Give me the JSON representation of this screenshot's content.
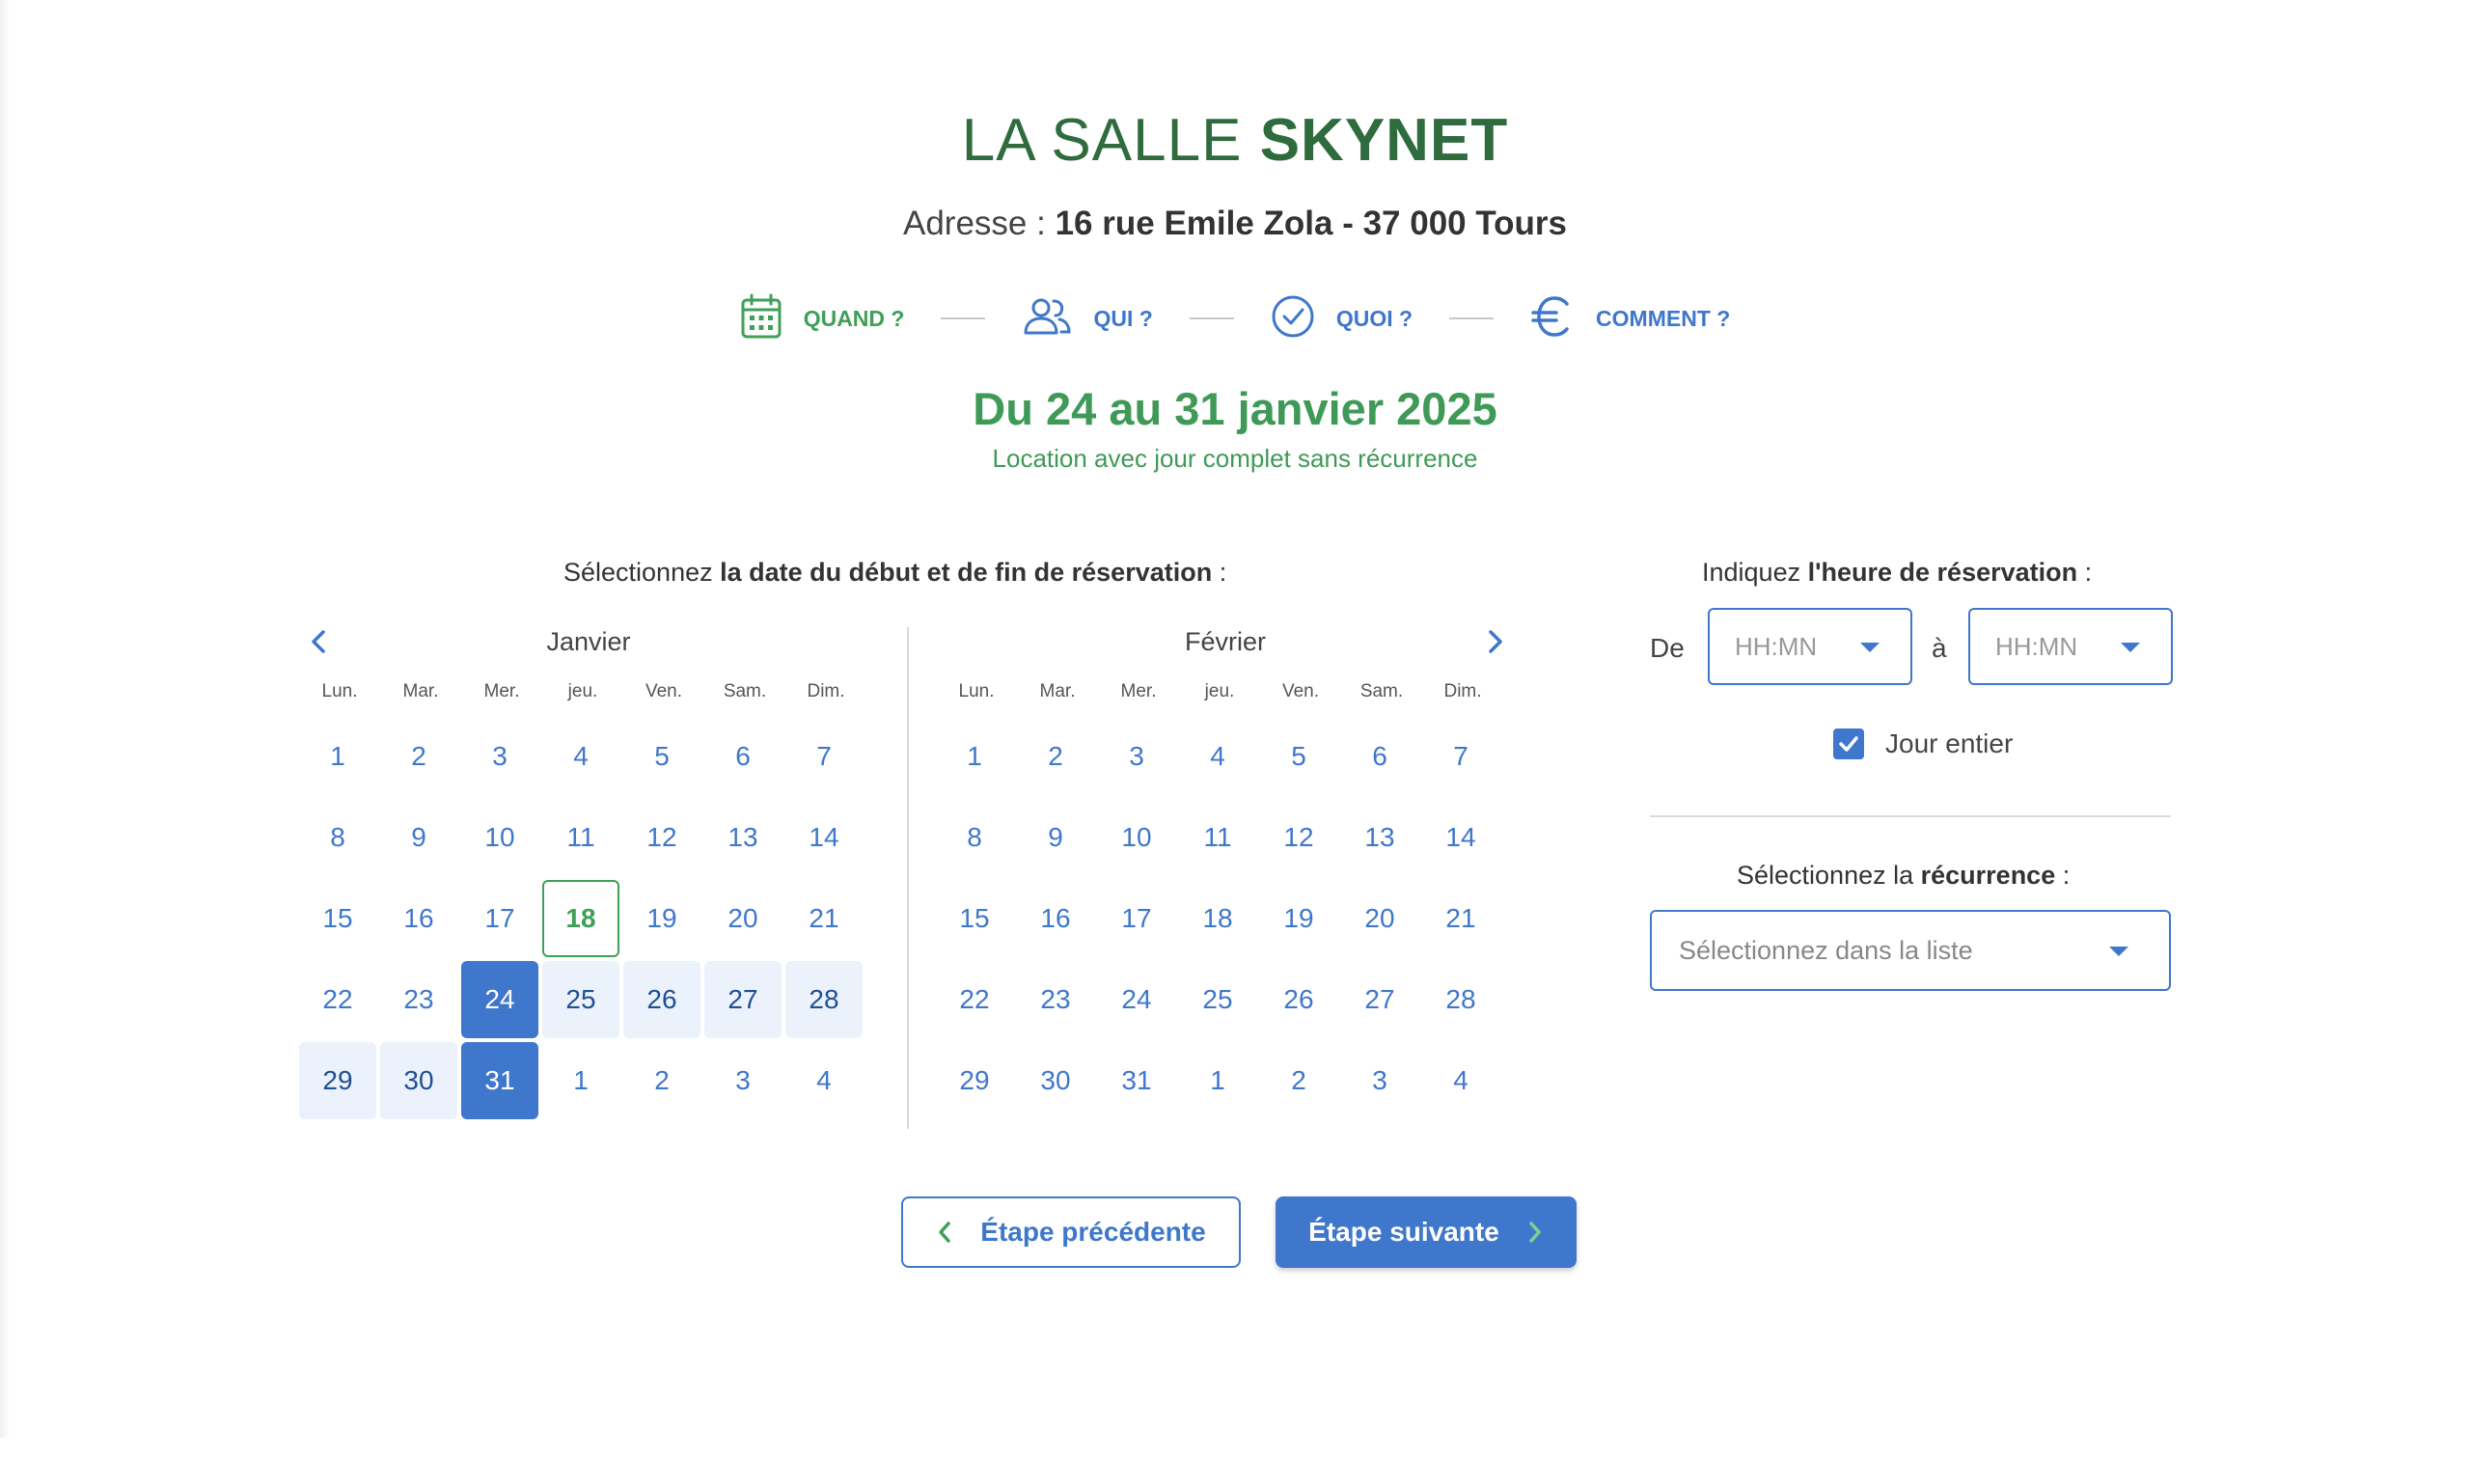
{
  "header": {
    "title_prefix": "LA SALLE",
    "title_name": "SKYNET",
    "address_label": "Adresse :",
    "address_value": "16 rue Emile Zola - 37 000 Tours"
  },
  "steps": [
    {
      "label": "QUAND ?",
      "icon": "calendar-icon",
      "state": "active"
    },
    {
      "label": "QUI ?",
      "icon": "people-icon",
      "state": "pending"
    },
    {
      "label": "QUOI ?",
      "icon": "check-circle-icon",
      "state": "pending"
    },
    {
      "label": "COMMENT ?",
      "icon": "euro-icon",
      "state": "pending"
    }
  ],
  "summary": {
    "period": "Du 24 au 31 janvier 2025",
    "subtitle": "Location avec jour complet sans récurrence"
  },
  "date_section": {
    "label_start": "Sélectionnez ",
    "label_bold": "la date du début et de fin de réservation",
    "label_end": " :"
  },
  "weekdays": [
    "Lun.",
    "Mar.",
    "Mer.",
    "jeu.",
    "Ven.",
    "Sam.",
    "Dim."
  ],
  "calendar_jan": {
    "name": "Janvier",
    "days": [
      {
        "d": "1"
      },
      {
        "d": "2"
      },
      {
        "d": "3"
      },
      {
        "d": "4"
      },
      {
        "d": "5"
      },
      {
        "d": "6"
      },
      {
        "d": "7"
      },
      {
        "d": "8"
      },
      {
        "d": "9"
      },
      {
        "d": "10"
      },
      {
        "d": "11"
      },
      {
        "d": "12"
      },
      {
        "d": "13"
      },
      {
        "d": "14"
      },
      {
        "d": "15"
      },
      {
        "d": "16"
      },
      {
        "d": "17"
      },
      {
        "d": "18",
        "state": "today"
      },
      {
        "d": "19"
      },
      {
        "d": "20"
      },
      {
        "d": "21"
      },
      {
        "d": "22"
      },
      {
        "d": "23"
      },
      {
        "d": "24",
        "state": "sel"
      },
      {
        "d": "25",
        "state": "range"
      },
      {
        "d": "26",
        "state": "range"
      },
      {
        "d": "27",
        "state": "range"
      },
      {
        "d": "28",
        "state": "range"
      },
      {
        "d": "29",
        "state": "range"
      },
      {
        "d": "30",
        "state": "range"
      },
      {
        "d": "31",
        "state": "sel"
      },
      {
        "d": "1"
      },
      {
        "d": "2"
      },
      {
        "d": "3"
      },
      {
        "d": "4"
      }
    ]
  },
  "calendar_feb": {
    "name": "Février",
    "days": [
      {
        "d": "1"
      },
      {
        "d": "2"
      },
      {
        "d": "3"
      },
      {
        "d": "4"
      },
      {
        "d": "5"
      },
      {
        "d": "6"
      },
      {
        "d": "7"
      },
      {
        "d": "8"
      },
      {
        "d": "9"
      },
      {
        "d": "10"
      },
      {
        "d": "11"
      },
      {
        "d": "12"
      },
      {
        "d": "13"
      },
      {
        "d": "14"
      },
      {
        "d": "15"
      },
      {
        "d": "16"
      },
      {
        "d": "17"
      },
      {
        "d": "18"
      },
      {
        "d": "19"
      },
      {
        "d": "20"
      },
      {
        "d": "21"
      },
      {
        "d": "22"
      },
      {
        "d": "23"
      },
      {
        "d": "24"
      },
      {
        "d": "25"
      },
      {
        "d": "26"
      },
      {
        "d": "27"
      },
      {
        "d": "28"
      },
      {
        "d": "29"
      },
      {
        "d": "30"
      },
      {
        "d": "31"
      },
      {
        "d": "1"
      },
      {
        "d": "2"
      },
      {
        "d": "3"
      },
      {
        "d": "4"
      }
    ]
  },
  "time_section": {
    "label_start": "Indiquez ",
    "label_bold": "l'heure de réservation",
    "label_end": " :",
    "from_label": "De",
    "to_label": "à",
    "from_placeholder": "HH:MN",
    "to_placeholder": "HH:MN",
    "full_day_label": "Jour entier",
    "full_day_checked": true
  },
  "recurrence": {
    "label_start": "Sélectionnez la ",
    "label_bold": "récurrence",
    "label_end": " :",
    "placeholder": "Sélectionnez dans la liste"
  },
  "buttons": {
    "prev": "Étape précédente",
    "next": "Étape suivante"
  },
  "colors": {
    "brand_green": "#2e6b3d",
    "accent_green": "#3fa057",
    "accent_blue": "#3f77cc",
    "range_bg": "#ebf2fc"
  }
}
